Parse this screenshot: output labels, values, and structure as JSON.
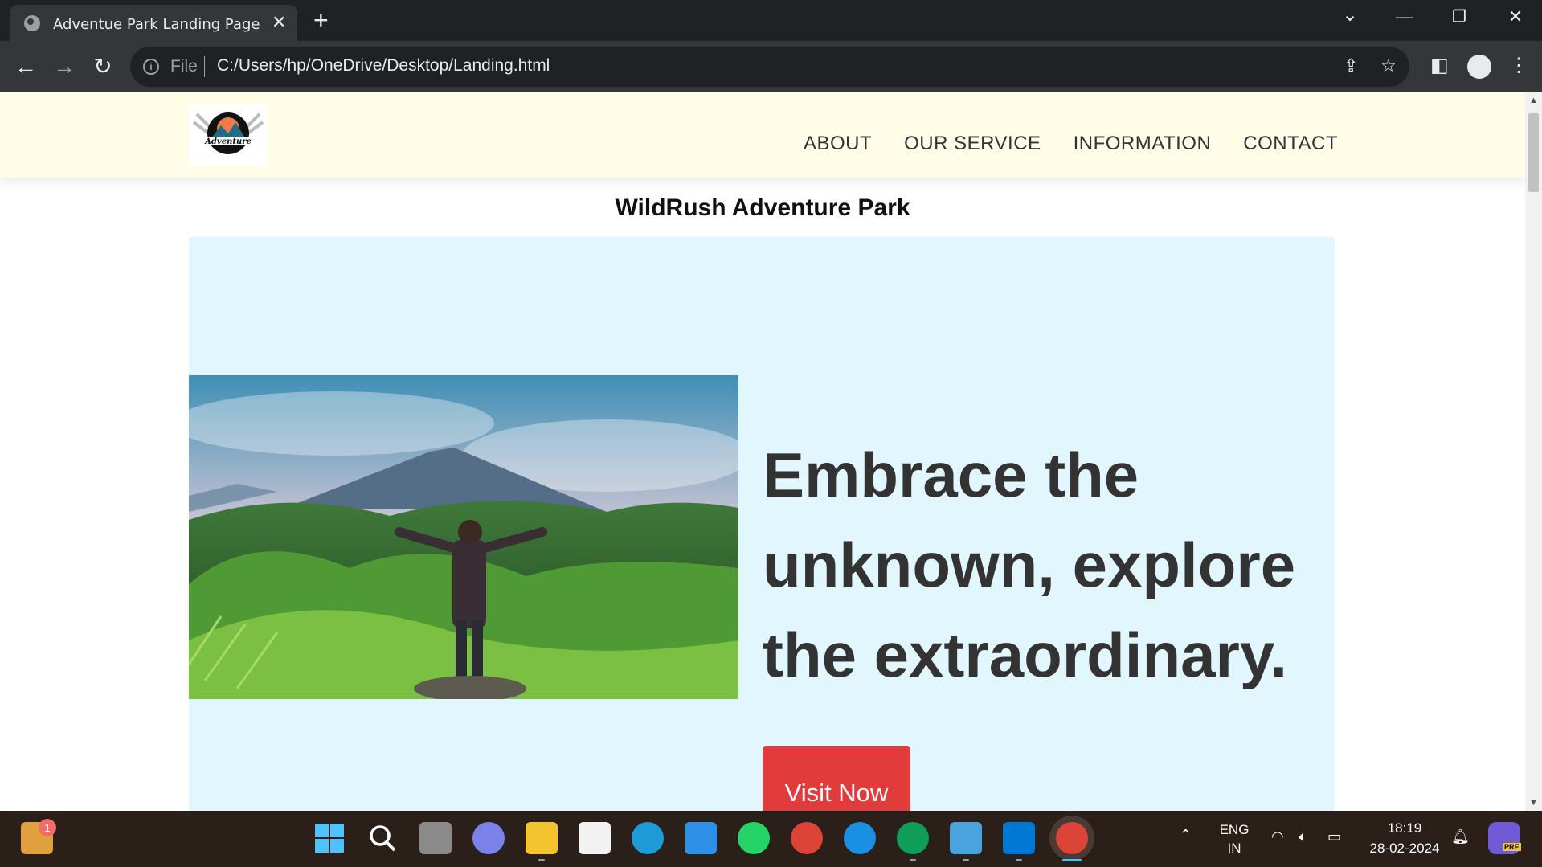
{
  "browser": {
    "tab_title": "Adventue Park Landing Page",
    "scheme_label": "File",
    "url": "C:/Users/hp/OneDrive/Desktop/Landing.html"
  },
  "site": {
    "nav": [
      "ABOUT",
      "OUR SERVICE",
      "INFORMATION",
      "CONTACT"
    ],
    "title": "WildRush Adventure Park",
    "logo_text": "Adventure",
    "hero_headline": "Embrace the unknown, explore the extraordinary.",
    "cta_label": "Visit Now"
  },
  "taskbar": {
    "widget_badge": "1",
    "lang_top": "ENG",
    "lang_bottom": "IN",
    "time": "18:19",
    "date": "28-02-2024",
    "tray_badge": "PRE"
  },
  "colors": {
    "header_bg": "#fffce8",
    "hero_bg": "#e2f7fd",
    "cta_bg": "#e23b3b"
  }
}
